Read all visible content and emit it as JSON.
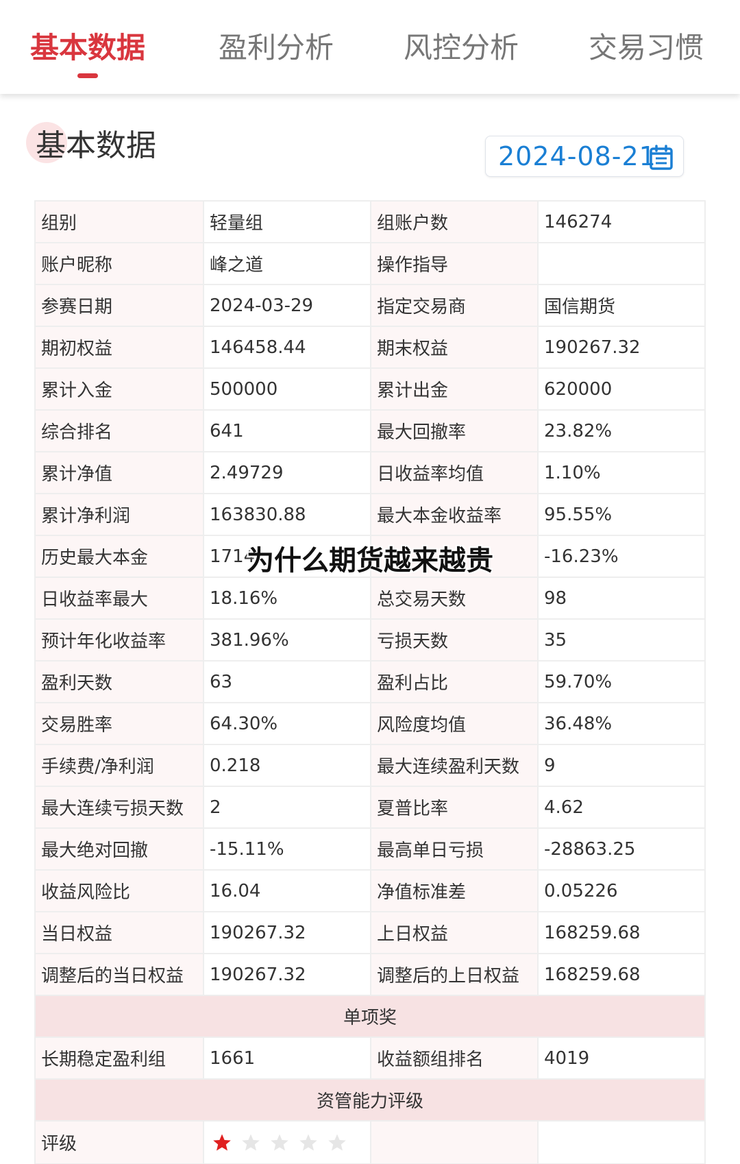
{
  "tabs": [
    {
      "label": "基本数据",
      "active": true
    },
    {
      "label": "盈利分析",
      "active": false
    },
    {
      "label": "风控分析",
      "active": false
    },
    {
      "label": "交易习惯",
      "active": false
    }
  ],
  "section": {
    "title": "基本数据"
  },
  "date_picker": {
    "value": "2024-08-21",
    "icon": "calendar-icon"
  },
  "colors": {
    "accent": "#d9363e",
    "date_text": "#1a7fd4",
    "label_bg": "#fdf6f6",
    "section_bg": "#f7e2e3",
    "star_active": "#e02020",
    "star_inactive": "#e6e6e6"
  },
  "rows": [
    [
      "组别",
      "轻量组",
      "组账户数",
      "146274"
    ],
    [
      "账户昵称",
      "峰之道",
      "操作指导",
      ""
    ],
    [
      "参赛日期",
      "2024-03-29",
      "指定交易商",
      "国信期货"
    ],
    [
      "期初权益",
      "146458.44",
      "期末权益",
      "190267.32"
    ],
    [
      "累计入金",
      "500000",
      "累计出金",
      "620000"
    ],
    [
      "综合排名",
      "641",
      "最大回撤率",
      "23.82%"
    ],
    [
      "累计净值",
      "2.49729",
      "日收益率均值",
      "1.10%"
    ],
    [
      "累计净利润",
      "163830.88",
      "最大本金收益率",
      "95.55%"
    ],
    [
      "历史最大本金",
      "1714",
      "",
      "-16.23%"
    ],
    [
      "日收益率最大",
      "18.16%",
      "总交易天数",
      "98"
    ],
    [
      "预计年化收益率",
      "381.96%",
      "亏损天数",
      "35"
    ],
    [
      "盈利天数",
      "63",
      "盈利占比",
      "59.70%"
    ],
    [
      "交易胜率",
      "64.30%",
      "风险度均值",
      "36.48%"
    ],
    [
      "手续费/净利润",
      "0.218",
      "最大连续盈利天数",
      "9"
    ],
    [
      "最大连续亏损天数",
      "2",
      "夏普比率",
      "4.62"
    ],
    [
      "最大绝对回撤",
      "-15.11%",
      "最高单日亏损",
      "-28863.25"
    ],
    [
      "收益风险比",
      "16.04",
      "净值标准差",
      "0.05226"
    ],
    [
      "当日权益",
      "190267.32",
      "上日权益",
      "168259.68"
    ],
    [
      "调整后的当日权益",
      "190267.32",
      "调整后的上日权益",
      "168259.68"
    ]
  ],
  "award_section": {
    "title": "单项奖"
  },
  "award_row": [
    "长期稳定盈利组",
    "1661",
    "收益额组排名",
    "4019"
  ],
  "rating_section": {
    "title": "资管能力评级"
  },
  "rating": {
    "label": "评级",
    "stars_filled": 1,
    "stars_total": 5
  },
  "overlay": {
    "text": "为什么期货越来越贵"
  }
}
